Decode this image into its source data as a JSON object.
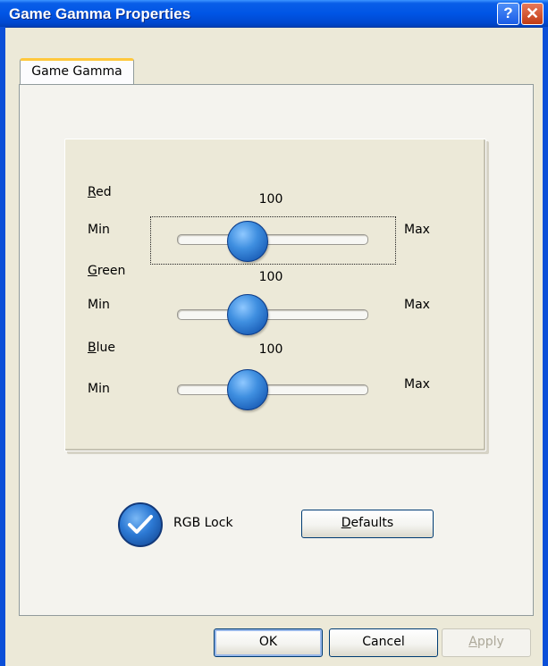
{
  "window": {
    "title": "Game Gamma Properties",
    "help_glyph": "?",
    "close_glyph": "✕"
  },
  "tabs": [
    {
      "label": "Game Gamma",
      "selected": true
    }
  ],
  "sliders": {
    "min_label": "Min",
    "max_label": "Max",
    "red": {
      "label_accel": "R",
      "label_rest": "ed",
      "value": "100"
    },
    "green": {
      "label_accel": "G",
      "label_rest": "reen",
      "value": "100"
    },
    "blue": {
      "label_accel": "B",
      "label_rest": "lue",
      "value": "100"
    }
  },
  "rgb_lock": {
    "label": "RGB Lock",
    "checked": true
  },
  "buttons": {
    "defaults_accel": "D",
    "defaults_rest": "efaults",
    "ok": "OK",
    "cancel": "Cancel",
    "apply_accel": "A",
    "apply_rest": "pply"
  },
  "colors": {
    "titlebar": "#0055e5",
    "dialog_bg": "#ece9d8",
    "thumb": "#3f8fe0",
    "tab_highlight": "#ffc83c"
  }
}
